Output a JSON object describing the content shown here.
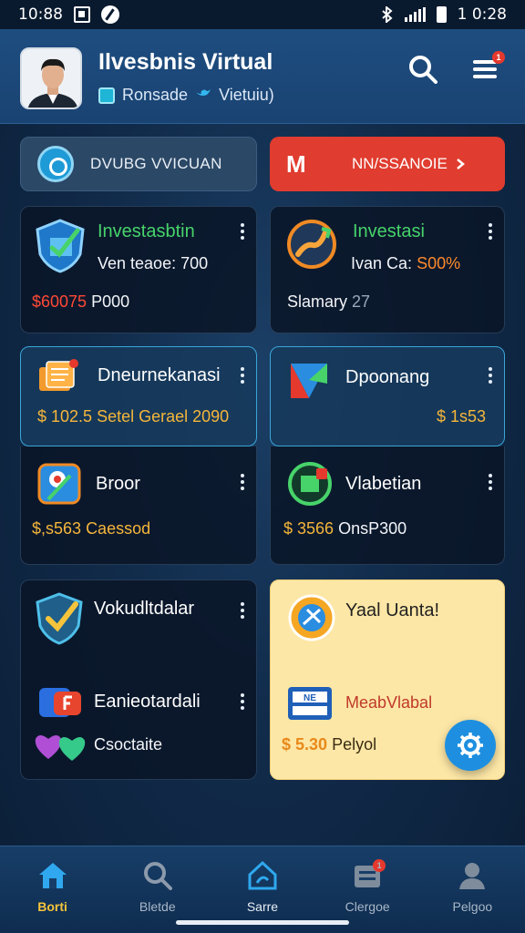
{
  "status_bar": {
    "time_left": "10:88",
    "time_right": "1 0:28"
  },
  "header": {
    "title": "Ilvesbnis Virtual",
    "sub_left": "Ronsade",
    "sub_right": "Vietuiu)",
    "menu_badge": "1"
  },
  "actions": {
    "left_label": "DVUBG VVICUAN",
    "right_mark": "M",
    "right_label": "NN/SSANOIE"
  },
  "cards": [
    {
      "title": "Investasbtin",
      "line1": "Ven teaoe: 700",
      "line2_value": "$60075",
      "line2_text": "P000"
    },
    {
      "title": "Investasi",
      "line1_prefix": "Ivan Ca:",
      "line1_value": "S00%",
      "line2_text": "Slamary",
      "line2_value": "27"
    },
    {
      "title": "Dneurnekanasi",
      "line1_value": "$ 102.5",
      "line1_text": "Setel Gerael 2090"
    },
    {
      "title": "Dpoonang",
      "line1_value": "$ 1s53"
    },
    {
      "title": "Broor",
      "line1_value": "$,s563",
      "line1_text": "Caessod"
    },
    {
      "title": "Vlabetian",
      "line1_value": "$ 3566",
      "line1_text": "OnsP300"
    },
    {
      "title": "Vokudltdalar",
      "line2_title": "Eanieotardali",
      "line3_text": "Csoctaite"
    },
    {
      "title": "Yaal Uanta!",
      "line2_text": "MeabVlabal",
      "line3_value": "$ 5.30",
      "line3_text": "Pelyol"
    }
  ],
  "nav": [
    {
      "label": "Borti",
      "state": "active"
    },
    {
      "label": "Bletde",
      "state": "normal"
    },
    {
      "label": "Sarre",
      "state": "blue"
    },
    {
      "label": "Clergoe",
      "state": "normal",
      "badge": "1"
    },
    {
      "label": "Pelgoo",
      "state": "normal"
    }
  ],
  "colors": {
    "accent": "#1e8fe0",
    "header": "#1e4d80",
    "action_red": "#e03c2f",
    "green_title": "#47d36a",
    "nav_active": "#f5c43c"
  }
}
